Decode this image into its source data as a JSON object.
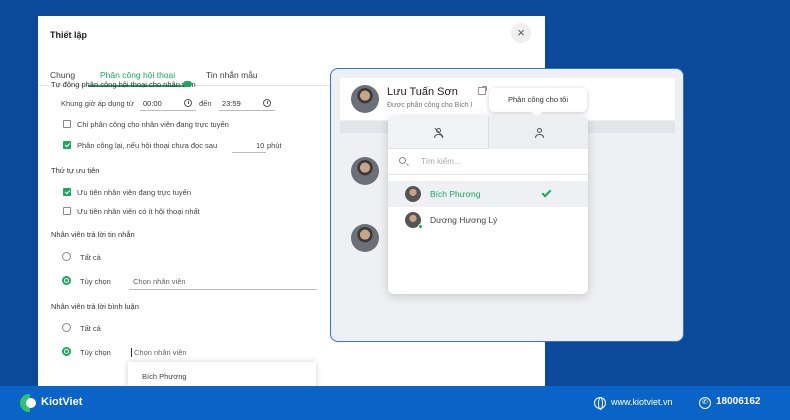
{
  "settings": {
    "title": "Thiết lập",
    "close": "×",
    "tabs": [
      "Chung",
      "Phân công hội thoại",
      "Tin nhắn mẫu"
    ],
    "auto_assign_label": "Tự động phân công hội thoại cho nhân viên",
    "auto_assign_on": true,
    "time_frame_label": "Khung giờ áp dụng từ",
    "time_from": "00:00",
    "to_label": "đến",
    "time_to": "23:59",
    "option_online_only": "Chỉ phân công cho nhân viên đang trực tuyến",
    "option_reassign_label": "Phân công lại, nếu hội thoại chưa đọc sau",
    "option_reassign_value": "10",
    "option_reassign_unit": "phút",
    "priority_title": "Thứ tự ưu tiên",
    "priority_online": "Ưu tiên nhân viên đang trực tuyến",
    "priority_least": "Ưu tiên nhân viên có ít hội thoại nhất",
    "reply_message_title": "Nhân viên trả lời tin nhắn",
    "reply_comment_title": "Nhân viên trả lời bình luận",
    "all_label": "Tất cả",
    "custom_label": "Tùy chọn",
    "select_staff_placeholder": "Chọn nhân viên",
    "dropdown_option": "Bích Phương"
  },
  "chat": {
    "name": "Lưu Tuấn Sơn",
    "subtitle": "Được phân công cho Bích I",
    "tooltip": "Phân công cho tôi",
    "search_placeholder": "Tìm kiếm...",
    "staff": [
      {
        "name": "Bích Phương",
        "selected": true
      },
      {
        "name": "Dương Hương Lý",
        "selected": false,
        "online": true
      }
    ]
  },
  "footer": {
    "brand": "KiotViet",
    "website": "www.kiotviet.vn",
    "hotline": "18006162"
  },
  "colors": {
    "accent": "#1aa860",
    "background": "#0b4a9a",
    "card_border": "#2d73d8",
    "footer": "#0a64c8"
  }
}
